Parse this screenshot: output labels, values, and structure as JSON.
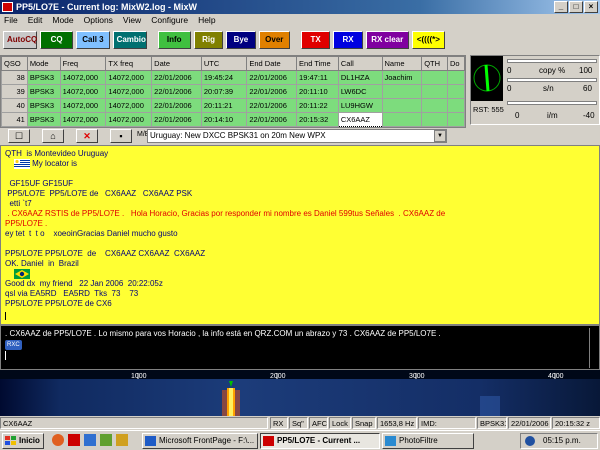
{
  "window": {
    "title": "PP5/LO7E - Current log: MixW2.log - MixW"
  },
  "menu": [
    "File",
    "Edit",
    "Mode",
    "Options",
    "View",
    "Configure",
    "Help"
  ],
  "macros": [
    {
      "label": "AutoCQ",
      "bg": "#c8c8c8",
      "fg": "#800000"
    },
    {
      "label": "CQ",
      "bg": "#007000",
      "fg": "#ffffff"
    },
    {
      "label": "Call 3",
      "bg": "#80c0ff",
      "fg": "#000000"
    },
    {
      "label": "Cambio",
      "bg": "#007070",
      "fg": "#ffffff"
    },
    {
      "label": "Info",
      "bg": "#40c040",
      "fg": "#000000"
    },
    {
      "label": "Rig",
      "bg": "#808000",
      "fg": "#ffffff"
    },
    {
      "label": "Bye",
      "bg": "#000080",
      "fg": "#ffffff"
    },
    {
      "label": "Over",
      "bg": "#e08000",
      "fg": "#000000"
    },
    {
      "label": "TX",
      "bg": "#e00000",
      "fg": "#ffffff"
    },
    {
      "label": "RX",
      "bg": "#0000e0",
      "fg": "#ffffff"
    },
    {
      "label": "RX clear",
      "bg": "#8000a0",
      "fg": "#ffffff"
    },
    {
      "label": "<((((*>",
      "bg": "#ffff00",
      "fg": "#000000"
    }
  ],
  "log": {
    "columns": [
      "QSO",
      "Mode",
      "Freq",
      "TX freq",
      "Date",
      "UTC",
      "End Date",
      "End Time",
      "Call",
      "Name",
      "QTH",
      "Do"
    ],
    "rows": [
      {
        "num": "38",
        "mode": "BPSK3",
        "freq": "14072,000",
        "txfreq": "14072,000",
        "date": "22/01/2006",
        "utc": "19:45:24",
        "enddate": "22/01/2006",
        "endtime": "19:47:11",
        "call": "DL1HZA",
        "name": "Joachim"
      },
      {
        "num": "39",
        "mode": "BPSK3",
        "freq": "14072,000",
        "txfreq": "14072,000",
        "date": "22/01/2006",
        "utc": "20:07:39",
        "enddate": "22/01/2006",
        "endtime": "20:11:10",
        "call": "LW6DC",
        "name": ""
      },
      {
        "num": "40",
        "mode": "BPSK3",
        "freq": "14072,000",
        "txfreq": "14072,000",
        "date": "22/01/2006",
        "utc": "20:11:21",
        "enddate": "22/01/2006",
        "endtime": "20:11:22",
        "call": "LU9HGW",
        "name": ""
      },
      {
        "num": "41",
        "mode": "BPSK3",
        "freq": "14072,000",
        "txfreq": "14072,000",
        "date": "22/01/2006",
        "utc": "20:14:10",
        "enddate": "22/01/2006",
        "endtime": "20:15:32",
        "call": "CX6AAZ",
        "name": ""
      }
    ]
  },
  "meters": {
    "copy_value": "0",
    "copy_label": "copy %",
    "copy_max": "100",
    "sn_value": "0",
    "sn_label": "s/n",
    "sn_max": "60",
    "rst": "RST: 555",
    "imd_value": "0",
    "imd_label": "i/m",
    "imd_max": "-40"
  },
  "toolbar": {
    "mode_label": "M/B",
    "news": "Uruguay:  New DXCC BPSK31 on 20m New WPX"
  },
  "rx_lines": [
    {
      "t": "QTH  is Montevideo Uruguay",
      "c": "navy",
      "flag": "uy",
      "t2": " My locator is"
    },
    {
      "t": "",
      "c": "navy"
    },
    {
      "t": "  GF15UF GF15UF",
      "c": "navy"
    },
    {
      "t": " PP5/LO7E  PP5/LO7E de   CX6AAZ   CX6AAZ PSK",
      "c": "navy"
    },
    {
      "t": "  etti `t7",
      "c": "navy"
    },
    {
      "t": " . CX6AAZ RSTIS de PP5/LO7E .   Hola Horacio, Gracias por responder mi nombre es Daniel 599tus Señales  . CX6AAZ de",
      "c": "red"
    },
    {
      "t": "PP5/LO7E .",
      "c": "red"
    },
    {
      "t": "ey tet  t  t o    xoeoinGracias Daniel mucho gusto",
      "c": "navy"
    },
    {
      "t": "",
      "c": "navy"
    },
    {
      "t": "PP5/LO7E PP5/LO7E  de    CX6AAZ CX6AAZ  CX6AAZ",
      "c": "navy"
    },
    {
      "t": "OK. Daniel  in  Brazil",
      "c": "navy",
      "flag": "br"
    },
    {
      "t": "Good dx  my friend   22 Jan 2006  20:22:05z",
      "c": "navy"
    },
    {
      "t": "qsl via EA5RD   EA5RD  Tks  73    73",
      "c": "navy"
    },
    {
      "t": "PP5/LO7E PP5/LO7E de CX6",
      "c": "navy"
    }
  ],
  "tx_text": " . CX6AAZ de PP5/LO7E .   Lo mismo para vos Horacio , la info está en QRZ.COM  un abrazo y 73 . CX6AAZ de PP5/LO7E .",
  "tx_tag": "RXC",
  "waterfall": {
    "scale": [
      "1000",
      "2000",
      "3000",
      "4000"
    ]
  },
  "status": {
    "call": "CX6AAZ",
    "rx": "RX",
    "sq": "Sq\"",
    "afc": "AFC",
    "lock": "Lock",
    "snap": "Snap",
    "freq": "1653,8 Hz",
    "imd": "IMD:",
    "mode": "BPSK31",
    "date": "22/01/2006",
    "time": "20:15:32 z"
  },
  "taskbar": {
    "start": "Inicio",
    "items": [
      {
        "label": "Microsoft FrontPage - F:\\..."
      },
      {
        "label": "PP5/LO7E - Current ..."
      },
      {
        "label": "PhotoFiltre"
      }
    ],
    "clock": "05:15 p.m."
  }
}
